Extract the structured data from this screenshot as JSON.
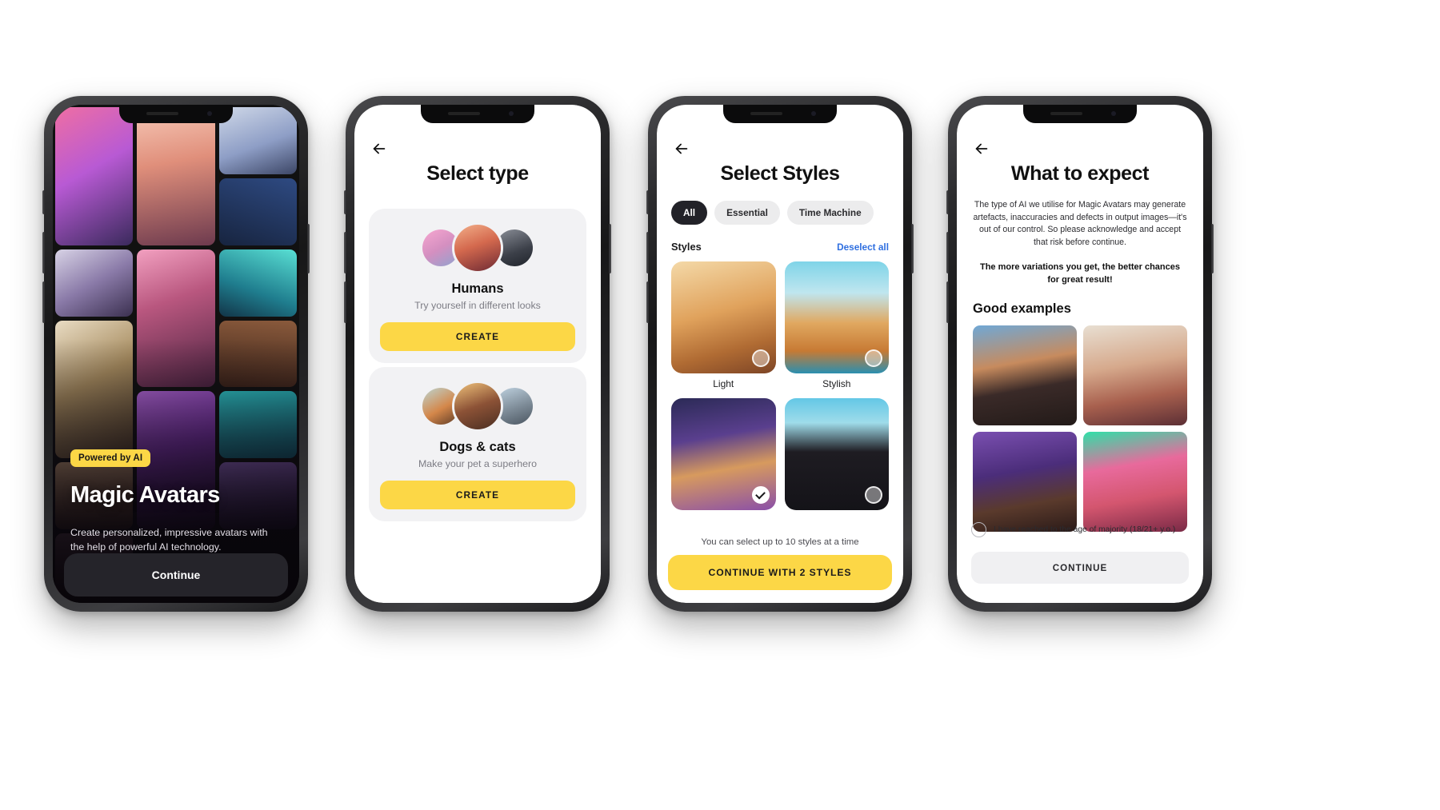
{
  "meta": {
    "accent_yellow": "#fcd746",
    "link_blue": "#2f6fe0",
    "dark": "#25242a"
  },
  "phone1": {
    "badge": "Powered by AI",
    "title": "Magic Avatars",
    "subtitle": "Create personalized, impressive avatars with the help of powerful AI technology.",
    "continue_label": "Continue"
  },
  "phone2": {
    "title": "Select type",
    "cards": [
      {
        "name": "Humans",
        "subtitle": "Try yourself in different looks",
        "button": "CREATE"
      },
      {
        "name": "Dogs & cats",
        "subtitle": "Make your pet a superhero",
        "button": "CREATE"
      }
    ]
  },
  "phone3": {
    "title": "Select Styles",
    "filters": [
      {
        "label": "All",
        "active": true
      },
      {
        "label": "Essential",
        "active": false
      },
      {
        "label": "Time Machine",
        "active": false
      }
    ],
    "styles_label": "Styles",
    "deselect_label": "Deselect all",
    "styles": [
      {
        "name": "Light",
        "selected": false
      },
      {
        "name": "Stylish",
        "selected": false
      },
      {
        "name": "",
        "selected": true
      },
      {
        "name": "",
        "selected": false
      }
    ],
    "hint": "You can select up to 10 styles at a time",
    "cta": "CONTINUE WITH 2 STYLES"
  },
  "phone4": {
    "title": "What to expect",
    "disclaimer": "The type of AI we utilise for Magic Avatars may generate artefacts, inaccuracies and defects in output images—it's out of our control. So please acknowledge and accept that risk before continue.",
    "emphasis": "The more variations you get, the better chances for great result!",
    "good_examples_title": "Good examples",
    "consent_text": "I have reached to the age of majority (18/21+ y.o.)",
    "continue_label": "CONTINUE"
  }
}
